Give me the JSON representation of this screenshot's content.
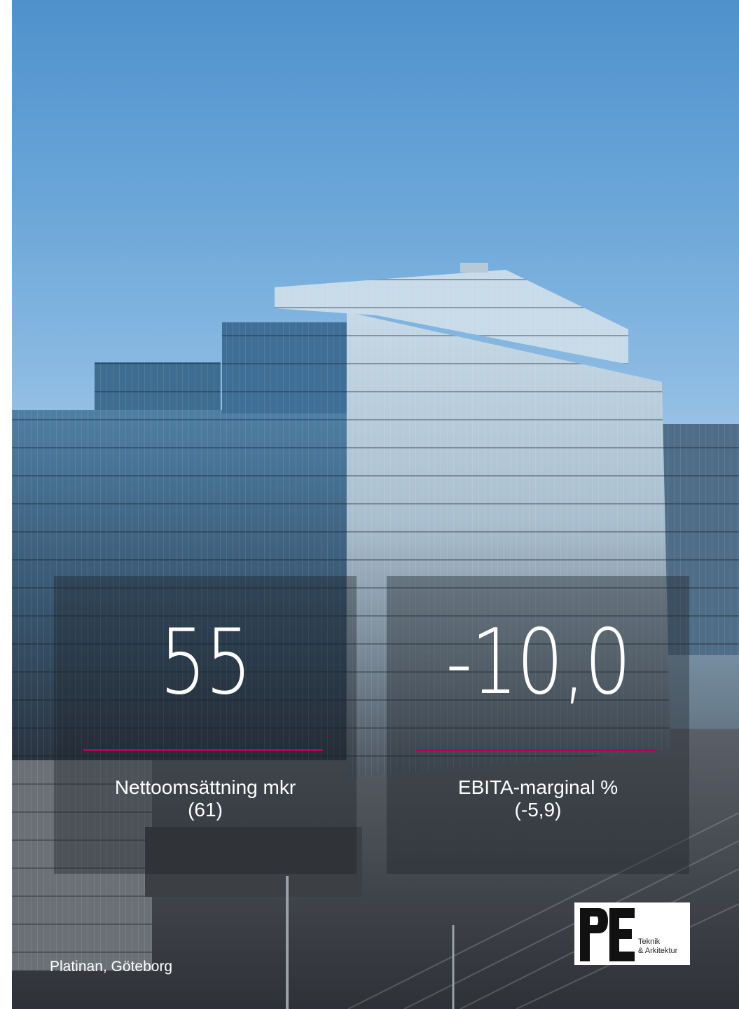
{
  "stats": [
    {
      "value": "55",
      "label": "Nettoomsättning mkr",
      "previous": "(61)"
    },
    {
      "value": "-10,0",
      "label": "EBITA-marginal %",
      "previous": "(-5,9)"
    }
  ],
  "caption": "Platinan, Göteborg",
  "logo": {
    "line1": "Teknik",
    "line2": "& Arkitektur"
  },
  "colors": {
    "accent_rule": "#b7005f",
    "text": "#ffffff"
  }
}
